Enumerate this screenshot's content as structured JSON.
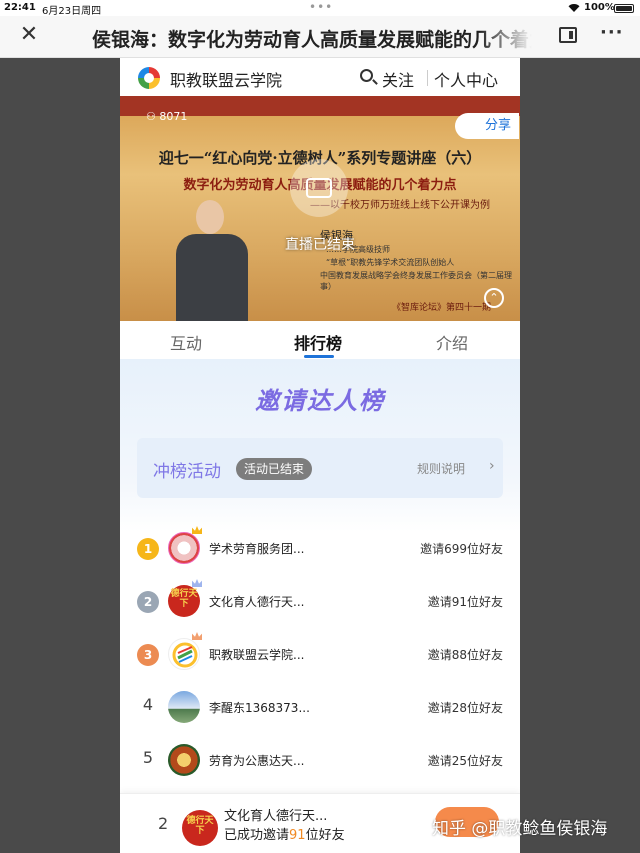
{
  "status": {
    "time": "22:41",
    "date": "6月23日周四",
    "battery": "100%",
    "dots": "•••"
  },
  "topbar": {
    "title": "侯银海：数字化为劳动育人高质量发展赋能的几个着力点",
    "close_glyph": "✕",
    "more_glyph": "···"
  },
  "app": {
    "name": "职教联盟云学院",
    "follow": "关注",
    "user_center": "个人中心"
  },
  "live": {
    "viewers": "8071",
    "viewer_icon": "person-icon",
    "share": "分享",
    "headline": "迎七一“红心向党·立德树人”系列专题讲座（六）",
    "subtitle": "数字化为劳动育人高质量发展赋能的几个着力点",
    "subtitle2": "——以千校万师万班线上线下公开课为例",
    "speaker": "侯银海",
    "line1": "……学院高级技师",
    "line2": "“草根”职教先锋学术交流团队创始人",
    "line3": "中国教育发展战略学会终身发展工作委员会（第二届理事）",
    "footer": "《智库论坛》第四十一期",
    "status": "直播已结束"
  },
  "tabs": [
    {
      "label": "互动",
      "active": false
    },
    {
      "label": "排行榜",
      "active": true
    },
    {
      "label": "介绍",
      "active": false
    }
  ],
  "rank": {
    "title": "邀请达人榜",
    "activity_label": "冲榜活动",
    "activity_badge": "活动已结束",
    "rules": "规则说明",
    "rows": [
      {
        "rank": "1",
        "name": "学术劳育服务团...",
        "invite": "邀请699位好友"
      },
      {
        "rank": "2",
        "name": "文化育人德行天...",
        "invite": "邀请91位好友"
      },
      {
        "rank": "3",
        "name": "职教联盟云学院...",
        "invite": "邀请88位好友"
      },
      {
        "rank": "4",
        "name": "李醒东1368373...",
        "invite": "邀请28位好友"
      },
      {
        "rank": "5",
        "name": "劳育为公惠达天...",
        "invite": "邀请25位好友"
      }
    ],
    "avatar_text": "德行天下"
  },
  "me": {
    "rank": "2",
    "name": "文化育人德行天...",
    "stat_prefix": "已成功邀请",
    "stat_count": "91",
    "stat_suffix": "位好友"
  },
  "watermark": "知乎 @职教鲶鱼侯银海",
  "colors": {
    "accent": "#1e73d9",
    "gold": "#f6b619",
    "silver": "#9aa6b4",
    "bronze": "#ec8b52",
    "title_purple": "#7b6be2",
    "highlight": "#f08a24"
  }
}
